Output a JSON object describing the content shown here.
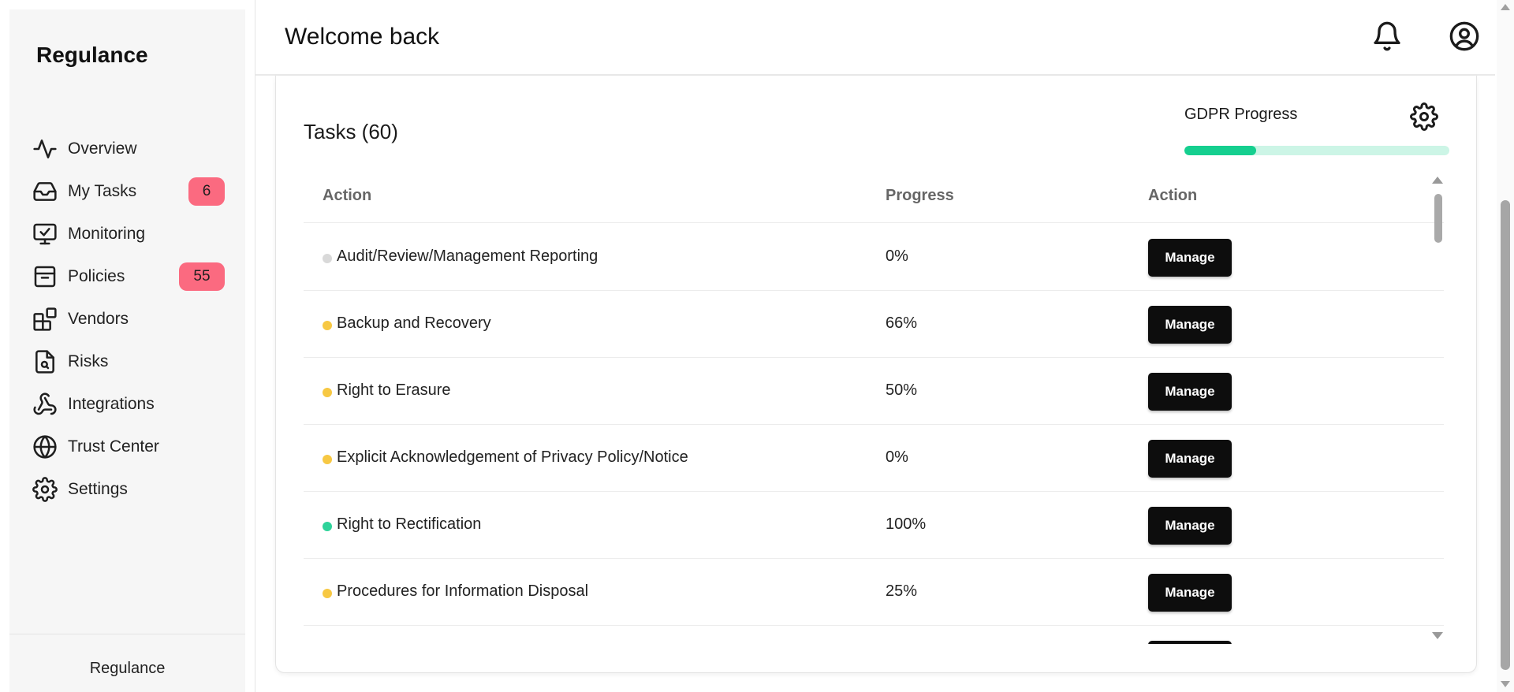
{
  "sidebar": {
    "brand": "Regulance",
    "items": [
      {
        "label": "Overview",
        "icon": "activity-icon"
      },
      {
        "label": "My Tasks",
        "icon": "inbox-icon",
        "badge": "6"
      },
      {
        "label": "Monitoring",
        "icon": "monitor-check-icon"
      },
      {
        "label": "Policies",
        "icon": "archive-icon",
        "badge": "55"
      },
      {
        "label": "Vendors",
        "icon": "blocks-icon"
      },
      {
        "label": "Risks",
        "icon": "file-search-icon"
      },
      {
        "label": "Integrations",
        "icon": "webhook-icon"
      },
      {
        "label": "Trust Center",
        "icon": "globe-icon"
      },
      {
        "label": "Settings",
        "icon": "gear-icon"
      }
    ],
    "footer": "Regulance",
    "badge_color": "#fb6a80"
  },
  "header": {
    "title": "Welcome back",
    "icons": [
      "bell-icon",
      "user-circle-icon"
    ]
  },
  "tasks": {
    "title": "Tasks (60)",
    "columns": [
      "Action",
      "Progress",
      "Action"
    ],
    "rows": [
      {
        "name": "Audit/Review/Management Reporting",
        "progress": "0%",
        "status_color": "#d9d9d9",
        "button": "Manage"
      },
      {
        "name": "Backup and Recovery",
        "progress": "66%",
        "status_color": "#f7c843",
        "button": "Manage"
      },
      {
        "name": "Right to Erasure",
        "progress": "50%",
        "status_color": "#f7c843",
        "button": "Manage"
      },
      {
        "name": "Explicit Acknowledgement of Privacy Policy/Notice",
        "progress": "0%",
        "status_color": "#f7c843",
        "button": "Manage"
      },
      {
        "name": "Right to Rectification",
        "progress": "100%",
        "status_color": "#2ed39a",
        "button": "Manage"
      },
      {
        "name": "Procedures for Information Disposal",
        "progress": "25%",
        "status_color": "#f7c843",
        "button": "Manage"
      }
    ]
  },
  "gdpr": {
    "label": "GDPR Progress",
    "progress_fraction": 0.27,
    "fill_color": "#15cf8f",
    "track_color": "#ccf5e6"
  }
}
